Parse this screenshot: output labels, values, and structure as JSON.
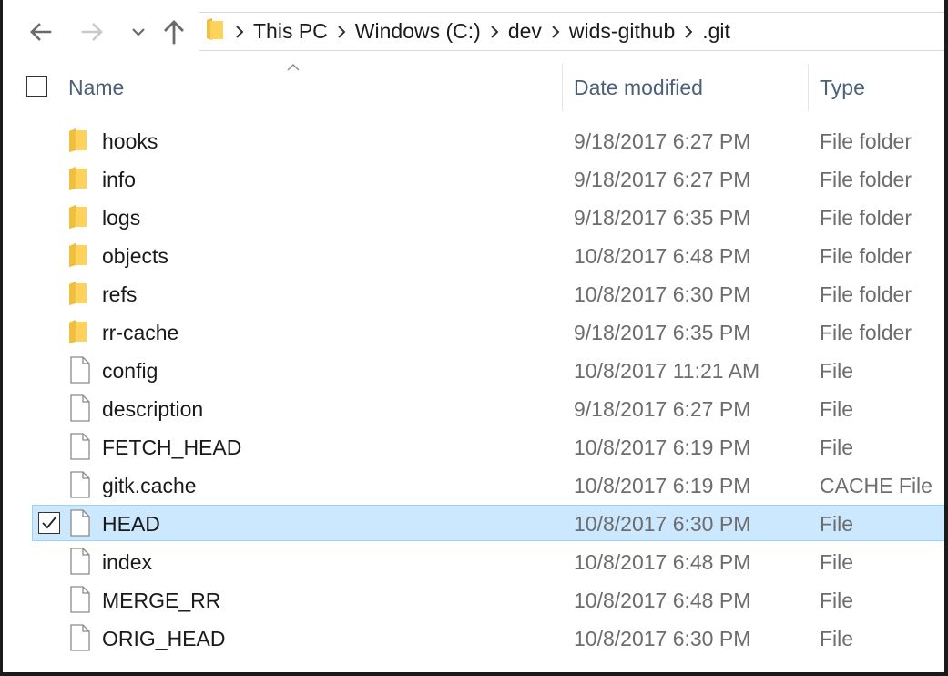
{
  "window": {
    "accent_selected_bg": "#cce8ff",
    "accent_selected_border": "#99d1ff",
    "header_text_color": "#4c607a",
    "folder_color": "#ffd35b"
  },
  "nav": {
    "back_icon": "arrow-left-icon",
    "forward_icon": "arrow-right-icon",
    "recent_icon": "chevron-down-icon",
    "up_icon": "arrow-up-icon"
  },
  "breadcrumb": {
    "icon": "folder-icon",
    "items": [
      "This PC",
      "Windows (C:)",
      "dev",
      "wids-github",
      ".git"
    ]
  },
  "columns": {
    "name": "Name",
    "date": "Date modified",
    "type": "Type",
    "sorted_by": "Name",
    "sort_direction": "ascending"
  },
  "files": [
    {
      "name": "hooks",
      "date": "9/18/2017 6:27 PM",
      "type": "File folder",
      "icon": "folder-icon",
      "selected": false
    },
    {
      "name": "info",
      "date": "9/18/2017 6:27 PM",
      "type": "File folder",
      "icon": "folder-icon",
      "selected": false
    },
    {
      "name": "logs",
      "date": "9/18/2017 6:35 PM",
      "type": "File folder",
      "icon": "folder-icon",
      "selected": false
    },
    {
      "name": "objects",
      "date": "10/8/2017 6:48 PM",
      "type": "File folder",
      "icon": "folder-icon",
      "selected": false
    },
    {
      "name": "refs",
      "date": "10/8/2017 6:30 PM",
      "type": "File folder",
      "icon": "folder-icon",
      "selected": false
    },
    {
      "name": "rr-cache",
      "date": "9/18/2017 6:35 PM",
      "type": "File folder",
      "icon": "folder-icon",
      "selected": false
    },
    {
      "name": "config",
      "date": "10/8/2017 11:21 AM",
      "type": "File",
      "icon": "file-icon",
      "selected": false
    },
    {
      "name": "description",
      "date": "9/18/2017 6:27 PM",
      "type": "File",
      "icon": "file-icon",
      "selected": false
    },
    {
      "name": "FETCH_HEAD",
      "date": "10/8/2017 6:19 PM",
      "type": "File",
      "icon": "file-icon",
      "selected": false
    },
    {
      "name": "gitk.cache",
      "date": "10/8/2017 6:19 PM",
      "type": "CACHE File",
      "icon": "file-icon",
      "selected": false
    },
    {
      "name": "HEAD",
      "date": "10/8/2017 6:30 PM",
      "type": "File",
      "icon": "file-icon",
      "selected": true
    },
    {
      "name": "index",
      "date": "10/8/2017 6:48 PM",
      "type": "File",
      "icon": "file-icon",
      "selected": false
    },
    {
      "name": "MERGE_RR",
      "date": "10/8/2017 6:48 PM",
      "type": "File",
      "icon": "file-icon",
      "selected": false
    },
    {
      "name": "ORIG_HEAD",
      "date": "10/8/2017 6:30 PM",
      "type": "File",
      "icon": "file-icon",
      "selected": false
    }
  ]
}
